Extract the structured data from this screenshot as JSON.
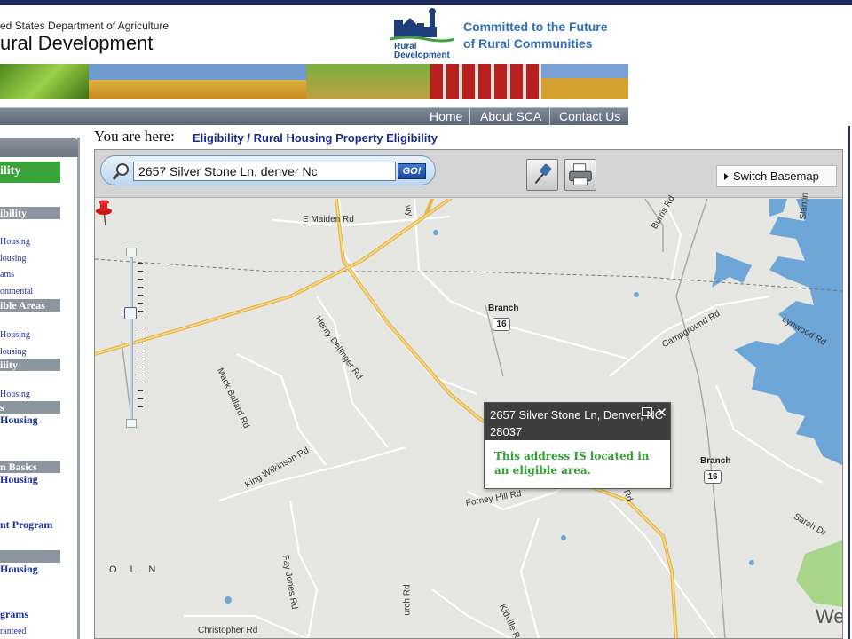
{
  "header": {
    "agency_line": "ed States Department of Agriculture",
    "agency_name": "ural Development",
    "logo_text_1": "Rural",
    "logo_text_2": "Development",
    "tagline_1": "Committed to the Future",
    "tagline_2": "of Rural Communities"
  },
  "nav": {
    "home": "Home",
    "about": "About SCA",
    "contact": "Contact Us"
  },
  "sidebar": {
    "green_label": "ility",
    "headings": [
      "ibility",
      "ible Areas",
      "ility",
      "s",
      "n Basics",
      "",
      ""
    ],
    "links": [
      "Housing",
      "lousing",
      "ams",
      "onmental",
      "Housing",
      "lousing",
      "Housing",
      "Housing",
      "Housing",
      "nt Program",
      "Housing",
      "grams",
      "ranteed"
    ]
  },
  "breadcrumb": {
    "lead": "You are here:",
    "path": "Eligibility / Rural Housing Property Eligibility"
  },
  "toolbar": {
    "search_value": "2657 Silver Stone Ln, denver Nc",
    "go_label": "GO!",
    "basemap_label": "Switch Basemap"
  },
  "map": {
    "road_labels": {
      "e_maiden": "E Maiden Rd",
      "burris": "Burris Rd",
      "slanting": "Slantin",
      "henry": "Henry Dellinger Rd",
      "mack": "Mack Ballard Rd",
      "campground": "Campground Rd",
      "lynwood": "Lynwood Rd",
      "king": "King Wilkinson Rd",
      "forney": "Forney Hill Rd",
      "fay": "Fay Jones Rd",
      "sarah": "Sarah Dr",
      "christopher": "Christopher Rd",
      "kidville": "Kidville Rd",
      "church": "urch Rd",
      "rd_suffix": "Rd",
      "way": "wy"
    },
    "places": {
      "branch_1": "Branch",
      "branch_2": "Branch",
      "olin": "O L N"
    },
    "shields": {
      "shield_1": "16",
      "shield_2": "16"
    },
    "watermark": "We"
  },
  "popup": {
    "title": "2657 Silver Stone Ln, Denver, NC 28037",
    "message": "This address IS located in an eligible area."
  },
  "colors": {
    "eligible_green": "#2ea02e",
    "nav_gray": "#6d7782",
    "water_blue": "#6ea6d8",
    "highway_yellow": "#f0c95a"
  }
}
